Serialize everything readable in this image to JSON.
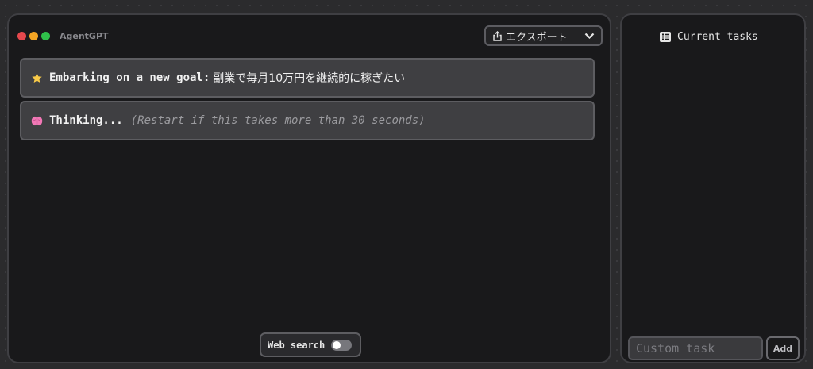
{
  "app": {
    "title": "AgentGPT"
  },
  "window_controls": {
    "close_color": "#e5484d",
    "minimize_color": "#f5a524",
    "maximize_color": "#2fbf4a"
  },
  "toolbar": {
    "export_label": "エクスポート",
    "export_icon": "share-icon",
    "chevron_icon": "chevron-down-icon"
  },
  "messages": [
    {
      "icon": "star-icon",
      "icon_color": "#f7c948",
      "prefix": "Embarking on a new goal:",
      "text": "副業で毎月10万円を継続的に稼ぎたい"
    },
    {
      "icon": "brain-icon",
      "icon_color": "#f277b6",
      "prefix": "Thinking...",
      "hint": "(Restart if this takes more than 30 seconds)"
    }
  ],
  "web_search": {
    "label": "Web search",
    "enabled": false
  },
  "tasks_panel": {
    "header": "Current tasks",
    "header_icon": "task-list-icon",
    "custom_task_placeholder": "Custom task",
    "add_label": "Add"
  },
  "colors": {
    "background": "#2b2b2d",
    "panel": "#19191b",
    "message": "#3f3f42",
    "border": "#5d5d61"
  }
}
